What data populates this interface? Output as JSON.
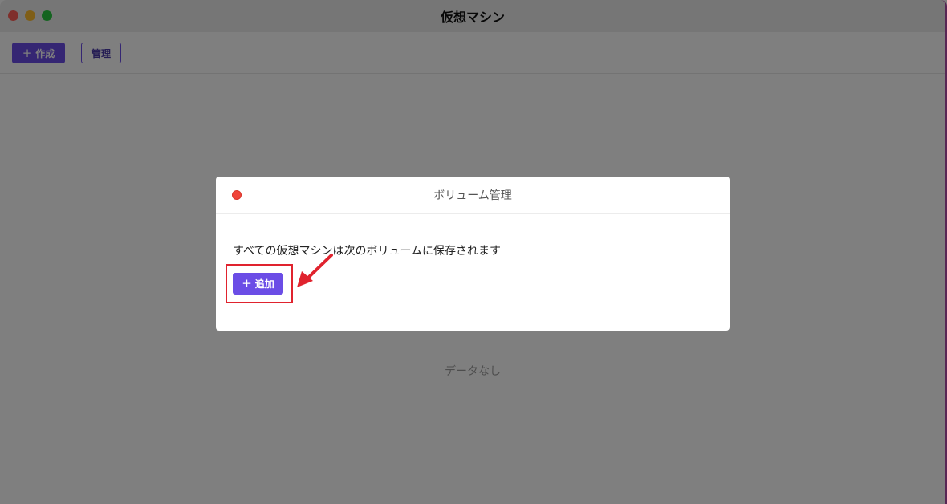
{
  "window": {
    "title": "仮想マシン"
  },
  "toolbar": {
    "create_label": "作成",
    "manage_label": "管理"
  },
  "main": {
    "empty_text": "データなし"
  },
  "modal": {
    "title": "ボリューム管理",
    "description": "すべての仮想マシンは次のボリュームに保存されます",
    "add_label": "追加"
  },
  "colors": {
    "accent": "#6b4de6",
    "highlight": "#e0232e"
  },
  "icons": {
    "create": "plus-icon",
    "add": "plus-icon",
    "close": "close-dot-icon"
  }
}
